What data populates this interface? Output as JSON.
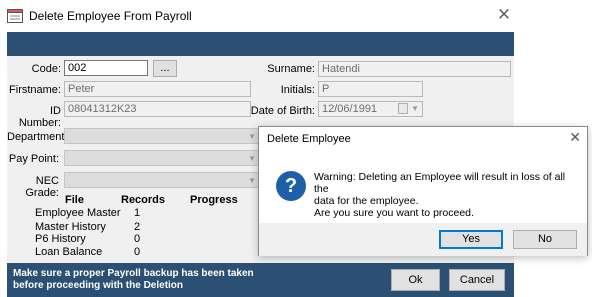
{
  "window": {
    "title": "Delete Employee From Payroll",
    "close_glyph": "✕",
    "icon": "payroll-app-icon"
  },
  "form": {
    "code_label": "Code:",
    "code_value": "002",
    "browse_label": "...",
    "surname_label": "Surname:",
    "surname_value": "Hatendi",
    "firstname_label": "Firstname:",
    "firstname_value": "Peter",
    "initials_label": "Initials:",
    "initials_value": "P",
    "id_label": "ID Number:",
    "id_value": "08041312K23",
    "dob_label": "Date of Birth:",
    "dob_value": "12/06/1991",
    "department_label": "Department:",
    "paypoint_label": "Pay Point:",
    "nec_label": "NEC Grade:"
  },
  "table": {
    "headers": {
      "file": "File",
      "records": "Records",
      "progress": "Progress"
    },
    "rows": [
      {
        "file": "Employee Master",
        "records": "1"
      },
      {
        "file": "Master History",
        "records": "2"
      },
      {
        "file": "P6 History",
        "records": "0"
      },
      {
        "file": "Loan Balance",
        "records": "0"
      }
    ]
  },
  "footer": {
    "message": "Make sure a proper Payroll backup has been taken before proceeding with the Deletion",
    "ok_label": "Ok",
    "cancel_label": "Cancel"
  },
  "dialog": {
    "title": "Delete Employee",
    "close_glyph": "✕",
    "icon": "question-icon",
    "icon_glyph": "?",
    "line1": "Warning: Deleting an Employee will result in loss of all the",
    "line2": "data for the employee.",
    "line3": "Are you sure you want to proceed.",
    "yes_label": "Yes",
    "no_label": "No"
  },
  "colors": {
    "band": "#2b5073",
    "form_bg": "#f0f0f0",
    "dialog_icon": "#1f5fa8",
    "default_button_border": "#0078d7"
  }
}
